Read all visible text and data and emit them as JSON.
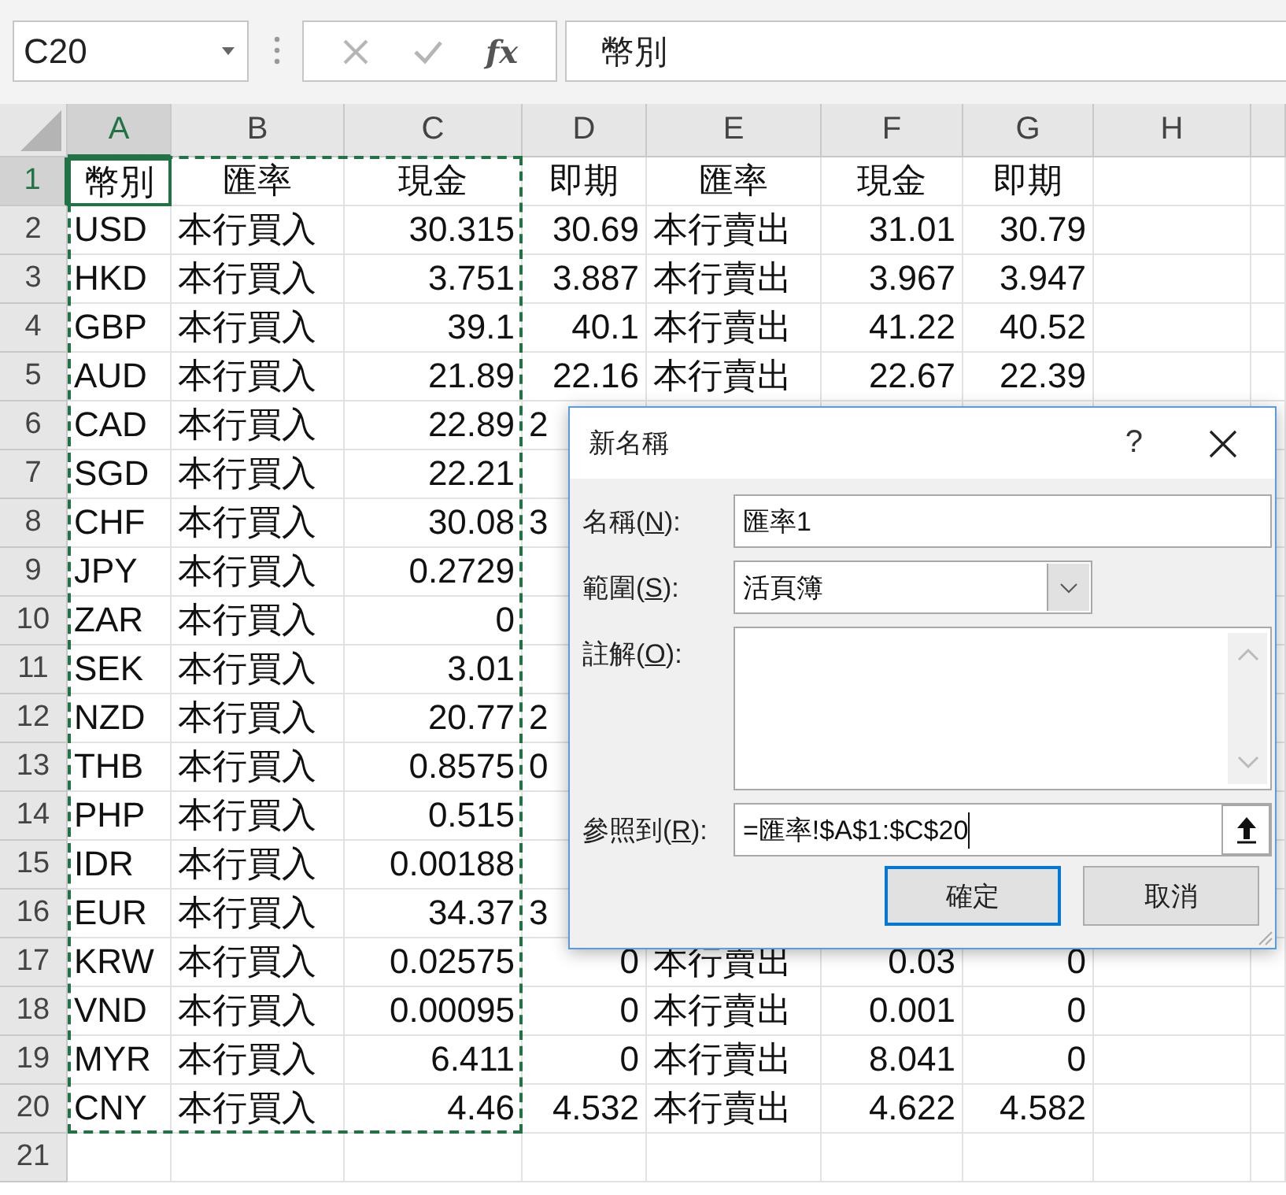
{
  "formula_bar": {
    "name_box": "C20",
    "function_label": "fx",
    "formula": "幣別"
  },
  "columns": [
    {
      "label": "A",
      "selected": true
    },
    {
      "label": "B",
      "selected": false
    },
    {
      "label": "C",
      "selected": false
    },
    {
      "label": "D",
      "selected": false
    },
    {
      "label": "E",
      "selected": false
    },
    {
      "label": "F",
      "selected": false
    },
    {
      "label": "G",
      "selected": false
    },
    {
      "label": "H",
      "selected": false
    }
  ],
  "rows": [
    {
      "label": "1",
      "selected": true,
      "kind": "header",
      "cells": [
        "幣別",
        "匯率",
        "現金",
        "即期",
        "匯率",
        "現金",
        "即期"
      ]
    },
    {
      "label": "2",
      "selected": false,
      "kind": "data",
      "cells": [
        "USD",
        "本行買入",
        "30.315",
        "30.69",
        "本行賣出",
        "31.01",
        "30.79"
      ]
    },
    {
      "label": "3",
      "selected": false,
      "kind": "data",
      "cells": [
        "HKD",
        "本行買入",
        "3.751",
        "3.887",
        "本行賣出",
        "3.967",
        "3.947"
      ]
    },
    {
      "label": "4",
      "selected": false,
      "kind": "data",
      "cells": [
        "GBP",
        "本行買入",
        "39.1",
        "40.1",
        "本行賣出",
        "41.22",
        "40.52"
      ]
    },
    {
      "label": "5",
      "selected": false,
      "kind": "data",
      "cells": [
        "AUD",
        "本行買入",
        "21.89",
        "22.16",
        "本行賣出",
        "22.67",
        "22.39"
      ]
    },
    {
      "label": "6",
      "selected": false,
      "kind": "partial",
      "cells": [
        "CAD",
        "本行買入",
        "22.89",
        "2"
      ]
    },
    {
      "label": "7",
      "selected": false,
      "kind": "partial",
      "cells": [
        "SGD",
        "本行買入",
        "22.21"
      ]
    },
    {
      "label": "8",
      "selected": false,
      "kind": "partial",
      "cells": [
        "CHF",
        "本行買入",
        "30.08",
        "3"
      ]
    },
    {
      "label": "9",
      "selected": false,
      "kind": "partial",
      "cells": [
        "JPY",
        "本行買入",
        "0.2729"
      ]
    },
    {
      "label": "10",
      "selected": false,
      "kind": "partial",
      "cells": [
        "ZAR",
        "本行買入",
        "0"
      ]
    },
    {
      "label": "11",
      "selected": false,
      "kind": "partial",
      "cells": [
        "SEK",
        "本行買入",
        "3.01"
      ]
    },
    {
      "label": "12",
      "selected": false,
      "kind": "partial",
      "cells": [
        "NZD",
        "本行買入",
        "20.77",
        "2"
      ]
    },
    {
      "label": "13",
      "selected": false,
      "kind": "partial",
      "cells": [
        "THB",
        "本行買入",
        "0.8575",
        "0"
      ]
    },
    {
      "label": "14",
      "selected": false,
      "kind": "partial",
      "cells": [
        "PHP",
        "本行買入",
        "0.515"
      ]
    },
    {
      "label": "15",
      "selected": false,
      "kind": "partial",
      "cells": [
        "IDR",
        "本行買入",
        "0.00188"
      ]
    },
    {
      "label": "16",
      "selected": false,
      "kind": "partial",
      "cells": [
        "EUR",
        "本行買入",
        "34.37",
        "3"
      ]
    },
    {
      "label": "17",
      "selected": false,
      "kind": "data",
      "cells": [
        "KRW",
        "本行買入",
        "0.02575",
        "0",
        "本行賣出",
        "0.03",
        "0"
      ]
    },
    {
      "label": "18",
      "selected": false,
      "kind": "data",
      "cells": [
        "VND",
        "本行買入",
        "0.00095",
        "0",
        "本行賣出",
        "0.001",
        "0"
      ]
    },
    {
      "label": "19",
      "selected": false,
      "kind": "data",
      "cells": [
        "MYR",
        "本行買入",
        "6.411",
        "0",
        "本行賣出",
        "8.041",
        "0"
      ]
    },
    {
      "label": "20",
      "selected": false,
      "kind": "data",
      "cells": [
        "CNY",
        "本行買入",
        "4.46",
        "4.532",
        "本行賣出",
        "4.622",
        "4.582"
      ]
    },
    {
      "label": "21",
      "selected": false,
      "kind": "empty"
    }
  ],
  "dialog": {
    "title": "新名稱",
    "help": "?",
    "fields": [
      {
        "kind": "text",
        "before": "名稱(",
        "accel": "N",
        "after": "):",
        "value": "匯率1"
      },
      {
        "kind": "select",
        "before": "範圍(",
        "accel": "S",
        "after": "):",
        "value": "活頁簿"
      },
      {
        "kind": "textarea",
        "before": "註解(",
        "accel": "O",
        "after": "):"
      },
      {
        "kind": "reference",
        "before": "參照到(",
        "accel": "R",
        "after": "):",
        "value": "=匯率!$A$1:$C$20"
      }
    ],
    "buttons": [
      {
        "label": "確定",
        "focused": true
      },
      {
        "label": "取消",
        "focused": false
      }
    ]
  }
}
